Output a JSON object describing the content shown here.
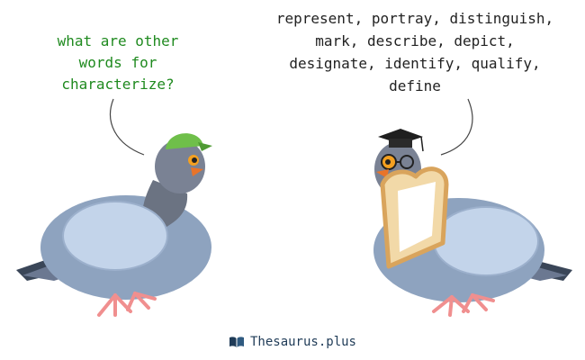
{
  "question": {
    "text": "what are other\nwords for\ncharacterize?",
    "color": "#1f8a1f"
  },
  "answer": {
    "text": "represent, portray, distinguish,\nmark, describe, depict,\ndesignate, identify, qualify,\ndefine",
    "color": "#222222"
  },
  "footer": {
    "brand": "Thesaurus.plus",
    "icon": "open-book-icon"
  },
  "colors": {
    "pigeon_body": "#8ea3bf",
    "pigeon_belly": "#c3d4ea",
    "pigeon_neck": "#6b7382",
    "feet": "#f08f8f",
    "beak": "#e8742a",
    "cap": "#6fbf4a",
    "toast": "#f2d9a8",
    "toast_crust": "#d9a45c"
  }
}
